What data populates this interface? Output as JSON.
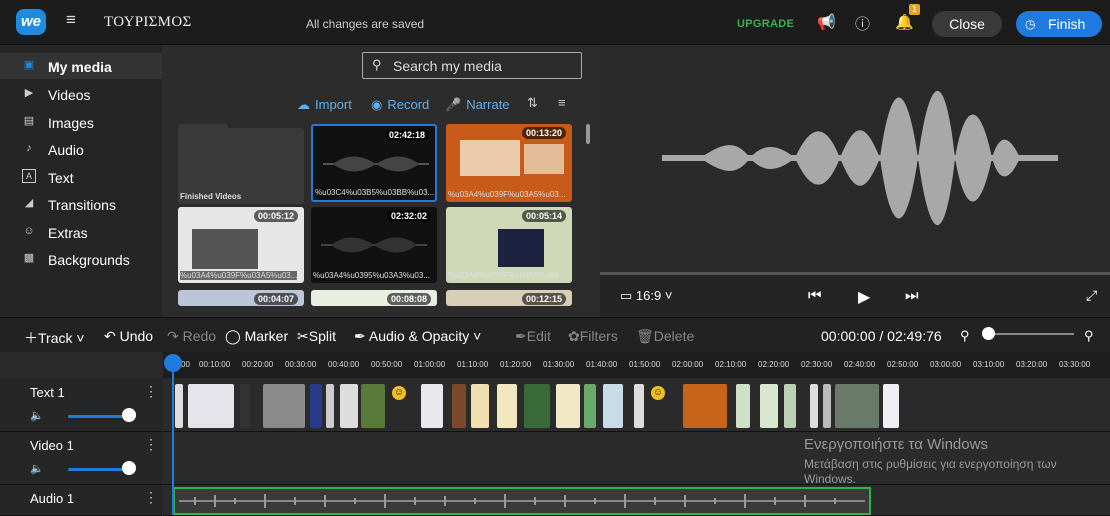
{
  "topbar": {
    "logo": "we",
    "project_title": "ΤΟΥΡΙΣΜΟΣ",
    "save_status": "All changes are saved",
    "upgrade": "UPGRADE",
    "notification_count": "1",
    "close": "Close",
    "finish": "Finish"
  },
  "sidebar": {
    "items": [
      {
        "label": "My media",
        "icon": "folder-icon"
      },
      {
        "label": "Videos",
        "icon": "video-icon"
      },
      {
        "label": "Images",
        "icon": "image-icon"
      },
      {
        "label": "Audio",
        "icon": "music-note-icon"
      },
      {
        "label": "Text",
        "icon": "text-icon"
      },
      {
        "label": "Transitions",
        "icon": "transitions-icon"
      },
      {
        "label": "Extras",
        "icon": "smiley-icon"
      },
      {
        "label": "Backgrounds",
        "icon": "backgrounds-icon"
      }
    ]
  },
  "media": {
    "search_placeholder": "Search my media",
    "import": "Import",
    "record": "Record",
    "narrate": "Narrate",
    "thumbs": [
      {
        "name": "Finished Videos",
        "duration": ""
      },
      {
        "name": "%u03C4%u03B5%u03BB%u03...",
        "duration": "02:42:18"
      },
      {
        "name": "%u03A4%u039F%u03A5%u03...",
        "duration": "00:13:20"
      },
      {
        "name": "%u03A4%u039F%u03A5%u03...",
        "duration": "00:05:12"
      },
      {
        "name": "%u03A4%u0395%u03A3%u03...",
        "duration": "02:32:02"
      },
      {
        "name": "%u03A4%u039F%u03A5%u03...",
        "duration": "00:05:14"
      },
      {
        "name": "",
        "duration": "00:04:07"
      },
      {
        "name": "",
        "duration": "00:08:08"
      },
      {
        "name": "",
        "duration": "00:12:15"
      }
    ]
  },
  "preview": {
    "aspect": "16:9"
  },
  "toolbar": {
    "track": "Track",
    "undo": "Undo",
    "redo": "Redo",
    "marker": "Marker",
    "split": "Split",
    "audio_opacity": "Audio & Opacity",
    "edit": "Edit",
    "filters": "Filters",
    "delete": "Delete",
    "timecode": "00:00:00 / 02:49:76"
  },
  "ruler": [
    "00",
    "00:10:00",
    "00:20:00",
    "00:30:00",
    "00:40:00",
    "00:50:00",
    "01:00:00",
    "01:10:00",
    "01:20:00",
    "01:30:00",
    "01:40:00",
    "01:50:00",
    "02:00:00",
    "02:10:00",
    "02:20:00",
    "02:30:00",
    "02:40:00",
    "02:50:00",
    "03:00:00",
    "03:10:00",
    "03:20:00",
    "03:30:00"
  ],
  "tracks": [
    {
      "name": "Text 1"
    },
    {
      "name": "Video 1"
    },
    {
      "name": "Audio 1"
    }
  ],
  "watermark": {
    "title": "Ενεργοποιήστε τα Windows",
    "subtitle": "Μετάβαση στις ρυθμίσεις για ενεργοποίηση των Windows."
  },
  "colors": {
    "accent": "#1f7be0",
    "upgrade": "#36b34a",
    "audio_border": "#2fb34a",
    "badge": "#e8a22a"
  }
}
